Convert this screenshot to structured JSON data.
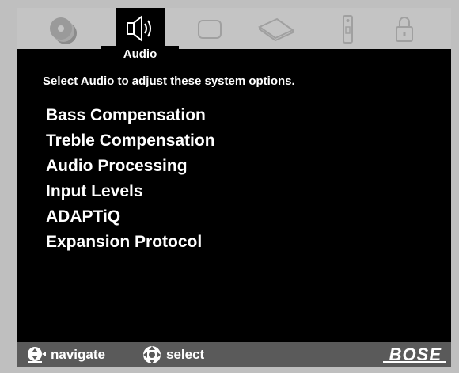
{
  "tabs": [
    {
      "icon": "disc-stack-icon",
      "active": false
    },
    {
      "icon": "speaker-icon",
      "active": true
    },
    {
      "icon": "screen-icon",
      "active": false
    },
    {
      "icon": "remote-device-icon",
      "active": false
    },
    {
      "icon": "remote-control-icon",
      "active": false
    },
    {
      "icon": "lock-icon",
      "active": false
    }
  ],
  "active_tab": {
    "label": "Audio"
  },
  "instructions": "Select Audio to adjust these system options.",
  "menu": {
    "items": [
      "Bass Compensation",
      "Treble Compensation",
      "Audio Processing",
      "Input Levels",
      "ADAPTiQ",
      "Expansion Protocol"
    ]
  },
  "footer": {
    "navigate_label": "navigate",
    "select_label": "select",
    "brand": "BOSE"
  },
  "colors": {
    "frame": "#bfbfbf",
    "screen": "#000000",
    "footer": "#5a5a5a",
    "text": "#ffffff"
  }
}
